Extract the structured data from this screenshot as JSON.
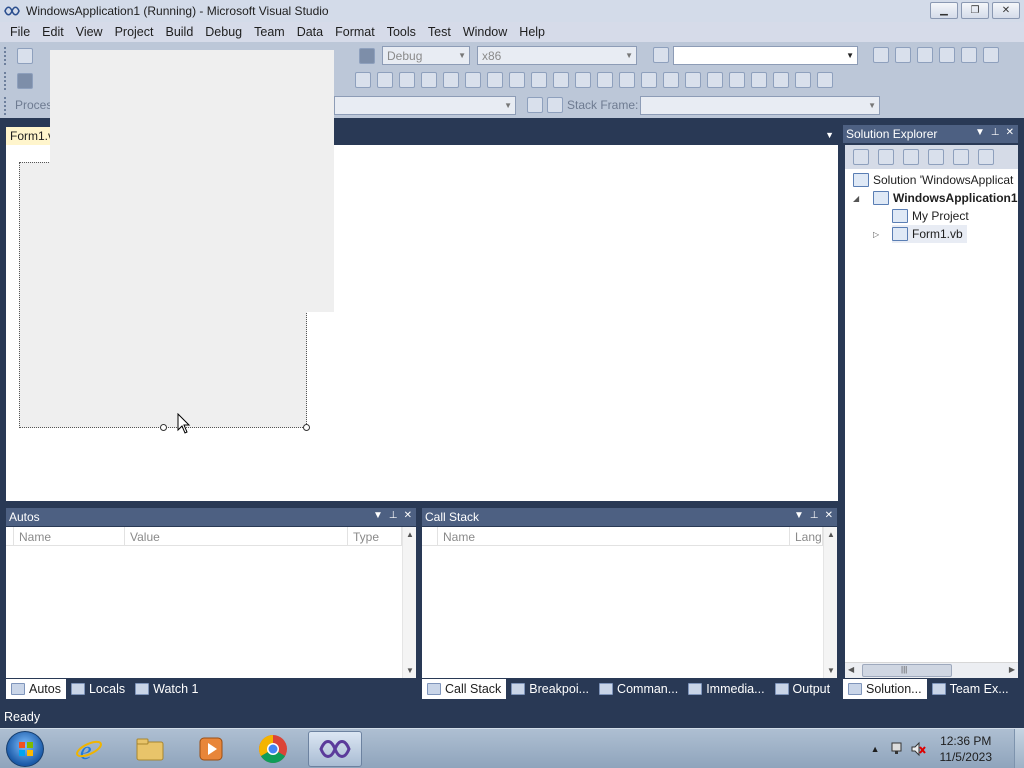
{
  "window": {
    "title": "WindowsApplication1 (Running) - Microsoft Visual Studio",
    "minimize_glyph": "▁",
    "restore_glyph": "❐",
    "close_glyph": "✕"
  },
  "menu": [
    "File",
    "Edit",
    "View",
    "Project",
    "Build",
    "Debug",
    "Team",
    "Data",
    "Format",
    "Tools",
    "Test",
    "Window",
    "Help"
  ],
  "toolbar": {
    "config_combo": "Debug",
    "platform_combo": "x86",
    "find_combo": "",
    "process_label": "Proces",
    "stack_frame_label": "Stack Frame:",
    "stack_frame_value": ""
  },
  "document": {
    "tab_label": "Form1.vb",
    "tab_dropdown_glyph": "▼"
  },
  "solution_explorer": {
    "title": "Solution Explorer",
    "ctrl_dropdown": "▼",
    "ctrl_pin": "⊥",
    "ctrl_close": "✕",
    "tree": [
      {
        "label": "Solution 'WindowsApplicat",
        "indent": 0,
        "bold": false
      },
      {
        "label": "WindowsApplication1",
        "indent": 1,
        "bold": true,
        "expander": "◢"
      },
      {
        "label": "My Project",
        "indent": 2,
        "bold": false
      },
      {
        "label": "Form1.vb",
        "indent": 2,
        "bold": false,
        "expander": "▷"
      }
    ],
    "scroll_grip": "|||"
  },
  "autos": {
    "title": "Autos",
    "columns": [
      "Name",
      "Value",
      "Type"
    ],
    "tabs": [
      "Autos",
      "Locals",
      "Watch 1"
    ]
  },
  "callstack": {
    "title": "Call Stack",
    "columns": [
      "Name",
      "Lang"
    ],
    "tabs": [
      "Call Stack",
      "Breakpoi...",
      "Comman...",
      "Immedia...",
      "Output"
    ]
  },
  "right_tabs": [
    "Solution...",
    "Team Ex..."
  ],
  "status": {
    "text": "Ready"
  },
  "taskbar": {
    "time": "12:36 PM",
    "date": "11/5/2023"
  }
}
